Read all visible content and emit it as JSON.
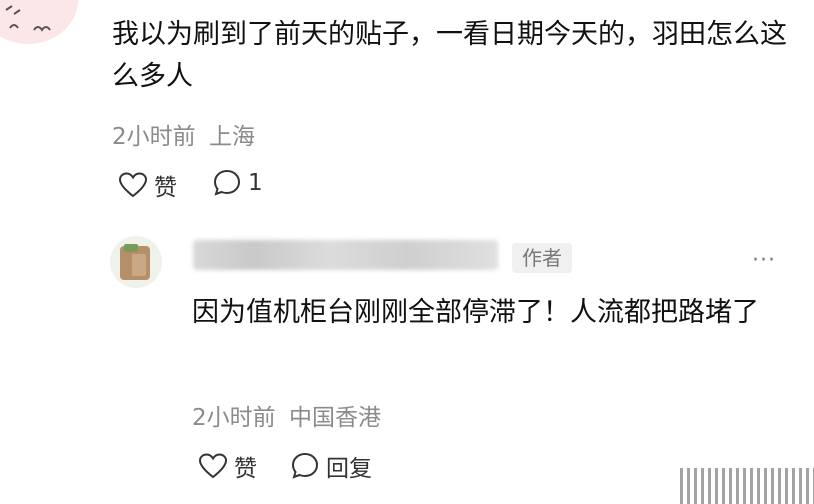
{
  "comment": {
    "text": "我以为刷到了前天的贴子，一看日期今天的，羽田怎么这么多人",
    "time": "2小时前",
    "location": "上海",
    "like_label": "赞",
    "reply_count": "1"
  },
  "reply": {
    "author_badge": "作者",
    "text": "因为值机柜台刚刚全部停滞了！人流都把路堵了",
    "time": "2小时前",
    "location": "中国香港",
    "like_label": "赞",
    "reply_label": "回复",
    "more": "···"
  }
}
